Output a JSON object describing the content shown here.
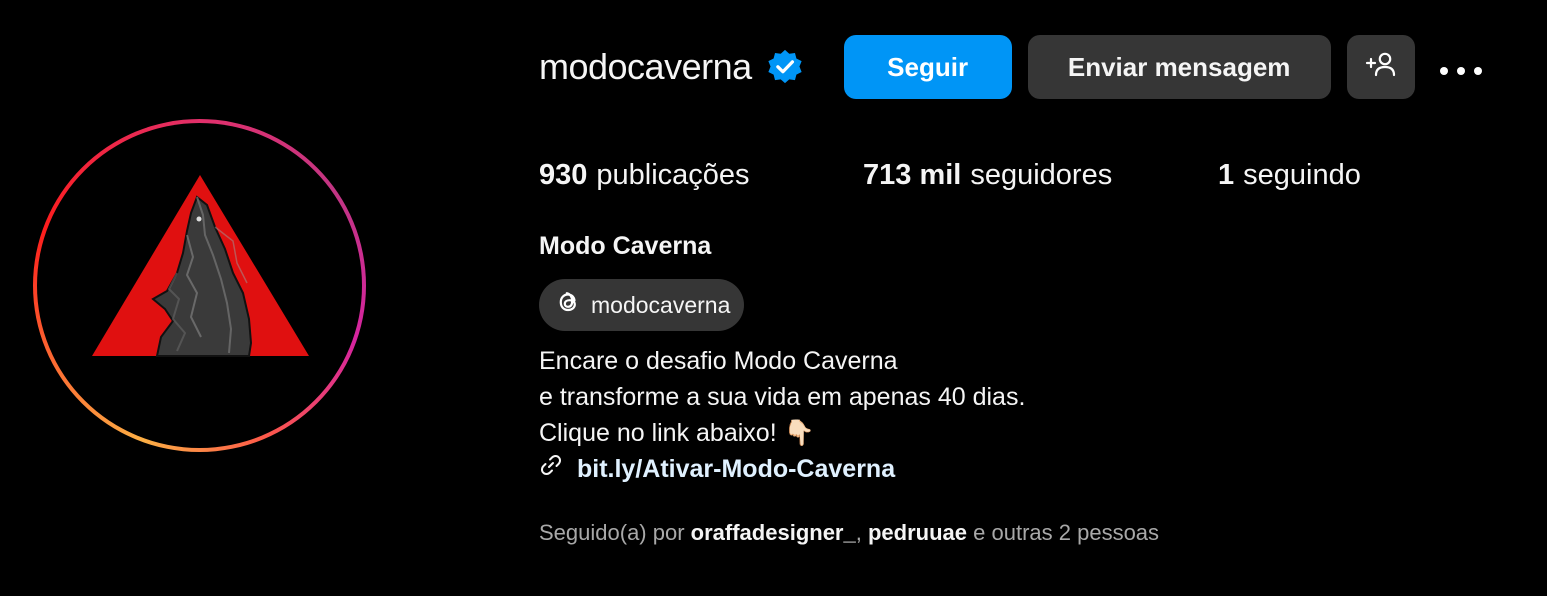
{
  "profile": {
    "username": "modocaverna",
    "display_name": "Modo Caverna",
    "threads_handle": "modocaverna"
  },
  "actions": {
    "follow_label": "Seguir",
    "message_label": "Enviar mensagem"
  },
  "stats": {
    "posts_value": "930",
    "posts_label": "publicações",
    "followers_value": "713 mil",
    "followers_label": "seguidores",
    "following_value": "1",
    "following_label": "seguindo"
  },
  "bio": {
    "line1": "Encare o desafio Modo Caverna",
    "line2": "e transforme a sua vida em apenas 40 dias.",
    "line3": "Clique no link abaixo! 👇🏻",
    "link": "bit.ly/Ativar-Modo-Caverna"
  },
  "followed_by": {
    "prefix": "Seguido(a) por",
    "user1": "oraffadesigner_",
    "separator": ",",
    "user2": "pedruuae",
    "suffix": "e outras 2 pessoas"
  },
  "colors": {
    "follow_button": "#0095f6",
    "secondary_button": "#363636",
    "verified_badge": "#0095f6",
    "logo_triangle": "#e01010"
  },
  "icons": {
    "verified": "verified-badge-icon",
    "add_user": "add-user-icon",
    "more": "more-horizontal-icon",
    "threads": "threads-icon",
    "link": "link-icon"
  }
}
